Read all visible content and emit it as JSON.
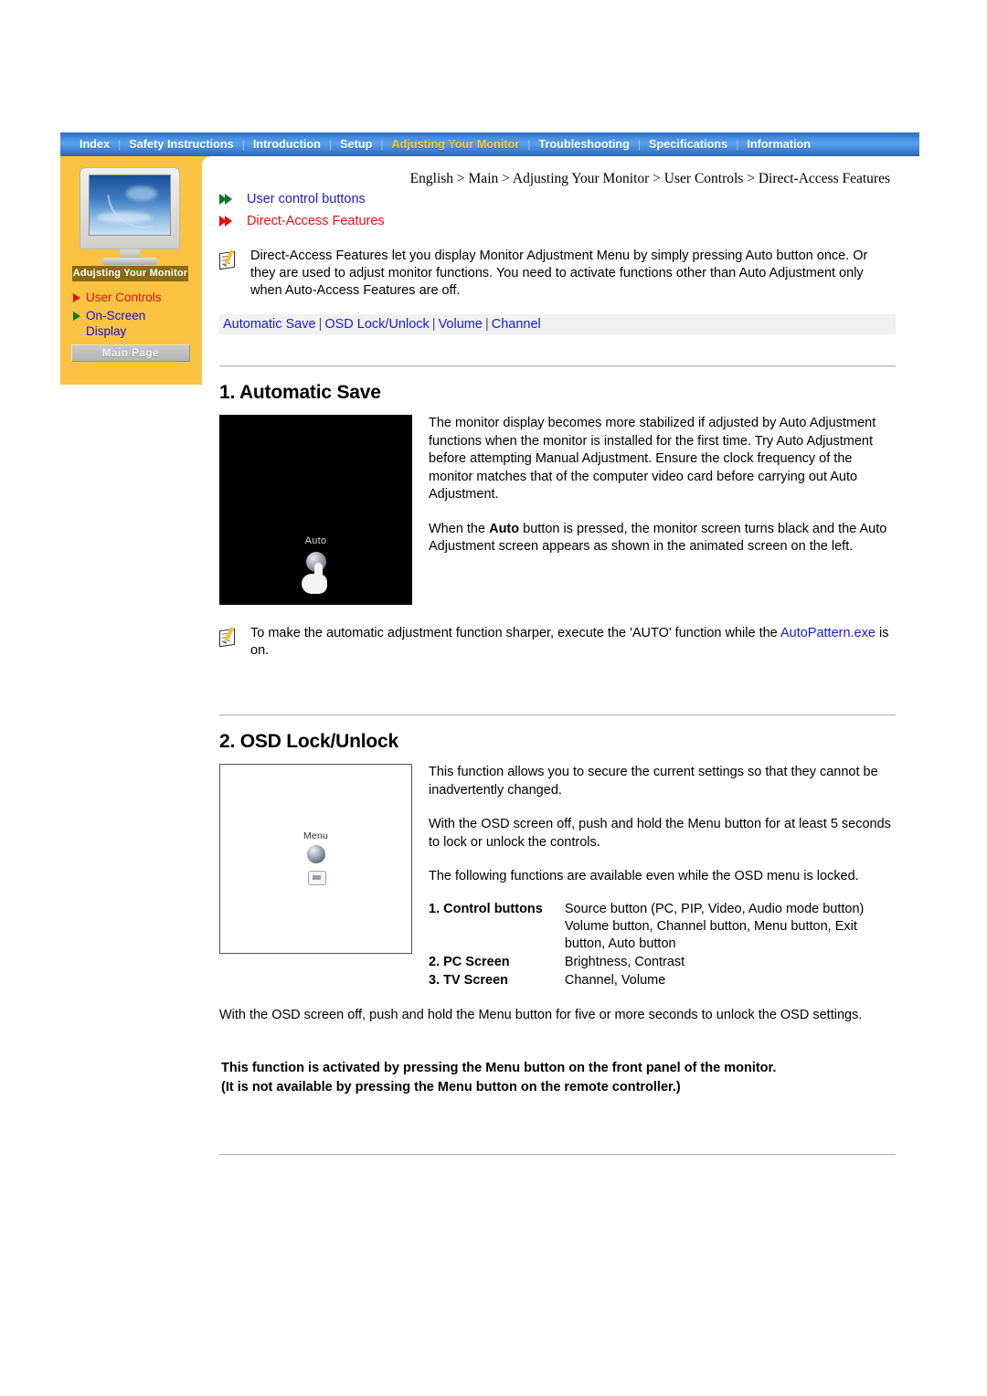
{
  "nav": {
    "items": [
      {
        "label": "Index",
        "active": false
      },
      {
        "label": "Safety Instructions",
        "active": false
      },
      {
        "label": "Introduction",
        "active": false
      },
      {
        "label": "Setup",
        "active": false
      },
      {
        "label": "Adjusting Your Monitor",
        "active": true
      },
      {
        "label": "Troubleshooting",
        "active": false
      },
      {
        "label": "Specifications",
        "active": false
      },
      {
        "label": "Information",
        "active": false
      }
    ],
    "separator": "|",
    "active_color": "#ffc61e",
    "bar_color": "#3f86d8"
  },
  "sidebar": {
    "thumb_caption": "Adujsting Your Monitor",
    "links": [
      {
        "label": "User Controls",
        "color": "#e81010",
        "marker_color": "#e81010"
      },
      {
        "label": "On-Screen",
        "label2": "Display",
        "color": "#1010dd",
        "marker_color": "#0a7a22"
      }
    ],
    "main_page_button": "Main Page"
  },
  "breadcrumb": "English > Main > Adjusting Your Monitor > User Controls > Direct-Access Features",
  "arrow_links": [
    {
      "label": "User control buttons",
      "marker_color": "#0a7a22",
      "text_color": "#1a1ad8"
    },
    {
      "label": "Direct-Access Features",
      "marker_color": "#e81010",
      "text_color": "#e81010"
    }
  ],
  "intro_note": "Direct-Access Features let you display Monitor Adjustment Menu by simply pressing Auto button once. Or they are used to adjust monitor functions. You need to activate functions other than Auto Adjustment only when Auto-Access Features are off.",
  "page_links": {
    "items": [
      "Automatic Save",
      "OSD Lock/Unlock",
      "Volume",
      "Channel"
    ],
    "separator": "|"
  },
  "section1": {
    "title": "1. Automatic Save",
    "image_label": "Auto",
    "paragraph1": "The monitor display becomes more stabilized if adjusted by Auto Adjustment functions when the monitor is installed for the first time. Try Auto Adjustment before attempting Manual Adjustment. Ensure the clock frequency of the monitor matches that of the computer video card before carrying out Auto Adjustment.",
    "paragraph2_pre": "When the ",
    "paragraph2_bold": "Auto",
    "paragraph2_post": " button is pressed, the monitor screen turns black and the Auto Adjustment screen appears as shown in the animated screen on the left.",
    "note_pre": "To make the automatic adjustment function sharper, execute the 'AUTO' function while the ",
    "note_link": "AutoPattern.exe",
    "note_post": " is on."
  },
  "section2": {
    "title": "2. OSD Lock/Unlock",
    "image_label": "Menu",
    "paragraph1": "This function allows you to secure the current settings so that they cannot be inadvertently changed.",
    "paragraph2": "With the OSD screen off, push and hold the Menu button for at least 5 seconds to lock or unlock the controls.",
    "paragraph3": "The following functions are available even while the OSD menu is locked.",
    "table": [
      {
        "key": "1. Control buttons",
        "value": "Source button (PC, PIP, Video, Audio mode button) Volume button, Channel button, Menu button, Exit button, Auto button"
      },
      {
        "key": "2. PC Screen",
        "value": "Brightness, Contrast"
      },
      {
        "key": "3. TV Screen",
        "value": "Channel, Volume"
      }
    ],
    "paragraph4": "With the OSD screen off, push and hold the Menu button for five or more seconds to unlock the OSD settings.",
    "bold_line1": "This function is activated by pressing the Menu button on the front panel of the monitor.",
    "bold_line2": "(It is not available by pressing the Menu button on the remote controller.)"
  }
}
